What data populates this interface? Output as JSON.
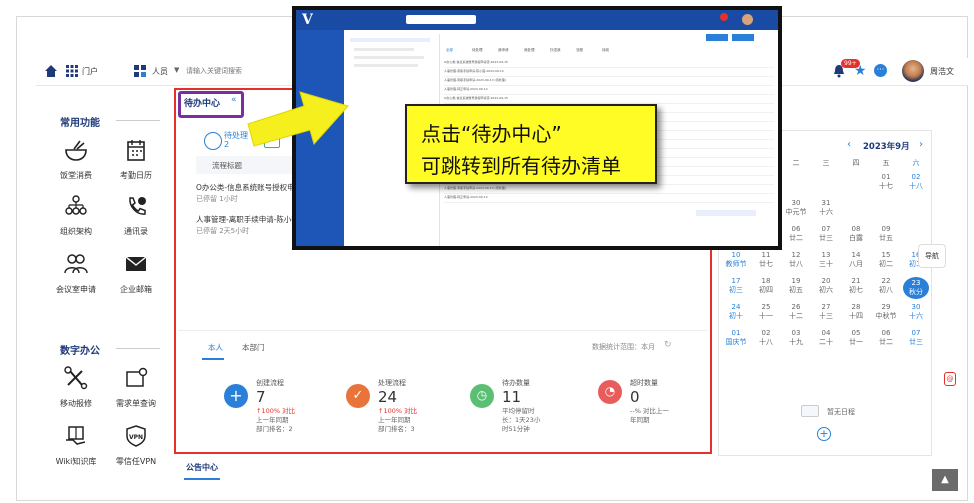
{
  "topbar": {
    "portal": "门户",
    "people": "人员",
    "search_placeholder": "请输入关键词搜索",
    "badge": "99+",
    "user_name": "周浩文"
  },
  "sidebar": {
    "common_title": "常用功能",
    "common_items": [
      "饭堂消费",
      "考勤日历",
      "组织架构",
      "通讯录",
      "会议室申请",
      "企业邮箱"
    ],
    "digital_title": "数字办公",
    "digital_items": [
      "移动报修",
      "需求单查询",
      "Wiki知识库",
      "零信任VPN"
    ]
  },
  "todo": {
    "title": "待办中心",
    "tab_pending": "待处理",
    "tab_pending_count": "2",
    "col_title": "流程标题",
    "items": [
      {
        "title": "O办公类-信息系统账号授权申请流",
        "time": "已停留 1小时"
      },
      {
        "title": "人事管理-离职手续申请-陈小强-2",
        "time": "已停留 2天5小时"
      }
    ]
  },
  "stats": {
    "tab_me": "本人",
    "tab_dept": "本部门",
    "range_label": "数据统计范围：本月",
    "cards": [
      {
        "label": "创建流程",
        "value": "7",
        "l1": "↑100% 对比",
        "l2": "上一年同期",
        "l3": "部门排名：2"
      },
      {
        "label": "处理流程",
        "value": "24",
        "l1": "↑100% 对比",
        "l2": "上一年同期",
        "l3": "部门排名：3"
      },
      {
        "label": "待办数量",
        "value": "11",
        "l1": "平均停留时",
        "l2": "长：1天23小",
        "l3": "时51分钟"
      },
      {
        "label": "超时数量",
        "value": "0",
        "l1": "--% 对比上一",
        "l2": "年同期",
        "l3": ""
      }
    ]
  },
  "notice": {
    "title": "公告中心"
  },
  "calendar": {
    "month": "2023年9月",
    "prev_tab": "月",
    "weekdays": [
      "",
      "一",
      "二",
      "三",
      "四",
      "五",
      "六"
    ],
    "rows": [
      [
        [
          "",
          ""
        ],
        [
          "",
          ""
        ],
        [
          "",
          ""
        ],
        [
          "",
          ""
        ],
        [
          "",
          ""
        ],
        [
          "01",
          "十七"
        ],
        [
          "02",
          "十八"
        ]
      ],
      [
        [
          "",
          ""
        ],
        [
          "29",
          "十四"
        ],
        [
          "30",
          "中元节"
        ],
        [
          "31",
          "十六"
        ],
        [
          "",
          ""
        ],
        [
          "",
          ""
        ],
        [
          "",
          ""
        ]
      ],
      [
        [
          "",
          ""
        ],
        [
          "05",
          "廿一"
        ],
        [
          "06",
          "廿二"
        ],
        [
          "07",
          "廿三"
        ],
        [
          "08",
          "白露"
        ],
        [
          "09",
          "廿五"
        ],
        [
          "",
          ""
        ]
      ],
      [
        [
          "10",
          "教师节"
        ],
        [
          "11",
          "廿七"
        ],
        [
          "12",
          "廿八"
        ],
        [
          "13",
          "三十"
        ],
        [
          "14",
          "八月"
        ],
        [
          "15",
          "初二"
        ],
        [
          "16",
          "初二"
        ]
      ],
      [
        [
          "17",
          "初三"
        ],
        [
          "18",
          "初四"
        ],
        [
          "19",
          "初五"
        ],
        [
          "20",
          "初六"
        ],
        [
          "21",
          "初七"
        ],
        [
          "22",
          "初八"
        ],
        [
          "23",
          "秋分"
        ]
      ],
      [
        [
          "24",
          "初十"
        ],
        [
          "25",
          "十一"
        ],
        [
          "26",
          "十二"
        ],
        [
          "27",
          "十三"
        ],
        [
          "28",
          "十四"
        ],
        [
          "29",
          "中秋节"
        ],
        [
          "30",
          "十六"
        ]
      ],
      [
        [
          "01",
          "国庆节"
        ],
        [
          "02",
          "十八"
        ],
        [
          "03",
          "十九"
        ],
        [
          "04",
          "二十"
        ],
        [
          "05",
          "廿一"
        ],
        [
          "06",
          "廿二"
        ],
        [
          "07",
          "廿三"
        ]
      ]
    ],
    "empty": "暂无日程",
    "nav_label": "导航"
  },
  "callout": {
    "line1": "点击“待办中心”",
    "line2": "可跳转到所有待办清单"
  },
  "overlay": {
    "brand": "V",
    "tabs": [
      "全部",
      "待处理",
      "我申请",
      "我处理",
      "抄送我",
      "流程",
      "待阅"
    ],
    "rows": [
      "O办公类-信息系统账号授权申请流-2023-09-15",
      "人事管理-离职手续申请-陈小强-2023-09-14",
      "人事管理-离职手续申请-2023-09-13 (待处理)",
      "人事管理-转正申请-2023-09-12"
    ]
  },
  "colors": {
    "accent": "#2a80d8",
    "red": "#e5302b",
    "purple": "#7a2fa0",
    "yellow": "#fffb24",
    "arrow": "#f6ef1e"
  }
}
